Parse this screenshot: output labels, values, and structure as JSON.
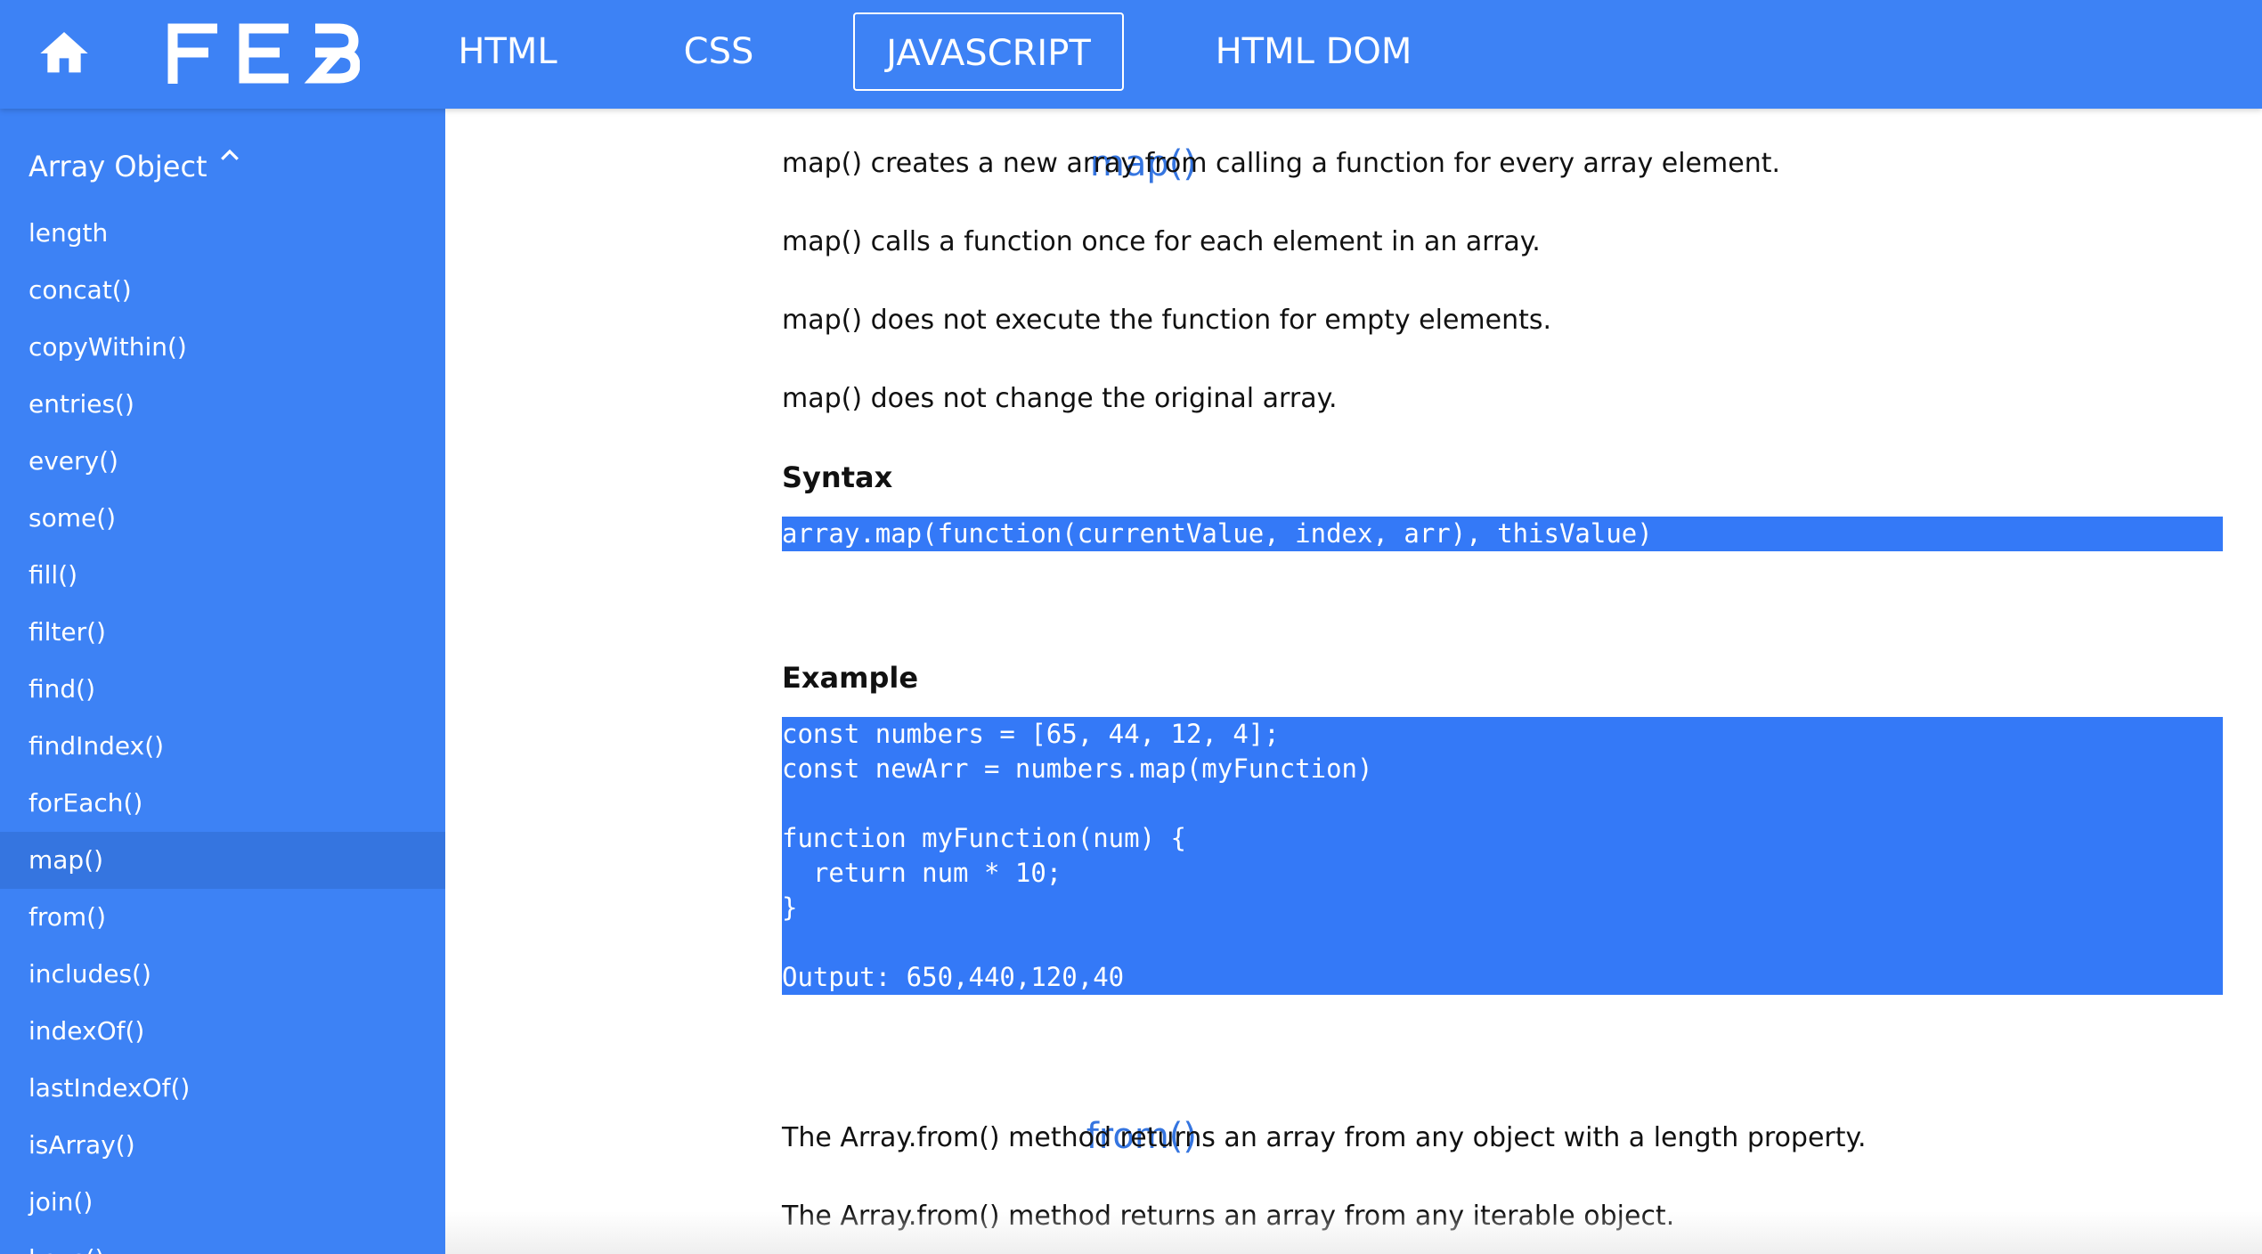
{
  "header": {
    "home_icon": "home-icon",
    "logo_text": "FEB",
    "nav": [
      {
        "label": "HTML"
      },
      {
        "label": "CSS"
      },
      {
        "label": "JAVASCRIPT",
        "active": true
      },
      {
        "label": "HTML DOM"
      }
    ]
  },
  "colors": {
    "primary": "#3d82f5",
    "sidebar_selected": "#3575e0",
    "code_bg": "#3479f7",
    "method_name": "#3575e0"
  },
  "sidebar": {
    "heading": "Array Object",
    "heading_icon": "chevron-up-icon",
    "items": [
      {
        "label": "length"
      },
      {
        "label": "concat()"
      },
      {
        "label": "copyWithin()"
      },
      {
        "label": "entries()"
      },
      {
        "label": "every()"
      },
      {
        "label": "some()"
      },
      {
        "label": "fill()"
      },
      {
        "label": "filter()"
      },
      {
        "label": "find()"
      },
      {
        "label": "findIndex()"
      },
      {
        "label": "forEach()"
      },
      {
        "label": "map()",
        "selected": true
      },
      {
        "label": "from()"
      },
      {
        "label": "includes()"
      },
      {
        "label": "indexOf()"
      },
      {
        "label": "lastIndexOf()"
      },
      {
        "label": "isArray()"
      },
      {
        "label": "join()"
      },
      {
        "label": "keys()"
      }
    ]
  },
  "content": {
    "map": {
      "name": "map()",
      "paragraphs": [
        "map() creates a new array from calling a function for every array element.",
        "map() calls a function once for each element in an array.",
        "map() does not execute the function for empty elements.",
        "map() does not change the original array."
      ],
      "syntax_label": "Syntax",
      "syntax_code": "array.map(function(currentValue, index, arr), thisValue)",
      "example_label": "Example",
      "example_code": "const numbers = [65, 44, 12, 4];\nconst newArr = numbers.map(myFunction)\n\nfunction myFunction(num) {\n  return num * 10;\n}\n\nOutput: 650,440,120,40"
    },
    "from": {
      "name": "from()",
      "paragraphs": [
        "The Array.from() method returns an array from any object with a length property.",
        "The Array.from() method returns an array from any iterable object."
      ]
    }
  }
}
